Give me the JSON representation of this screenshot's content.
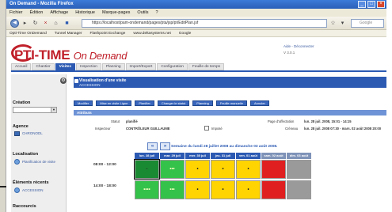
{
  "window": {
    "title": "On Demand - Mozilla Firefox",
    "buttons": [
      "_",
      "□",
      "×"
    ]
  },
  "menu": [
    "Fichier",
    "Édition",
    "Affichage",
    "Historique",
    "Marque-pages",
    "Outils",
    "?"
  ],
  "nav": {
    "url": "https://localhost/pam-ondemand/pages/pta/jsp/pt/EditPlan.jsf",
    "search_placeholder": "Google"
  },
  "bookmarks": [
    "Opti-Time OnDemand",
    "Tunnel Manager",
    "Flashpoint Exchange",
    "www.deltasystems.net",
    "Google"
  ],
  "brand": {
    "logo_main": "PTI-TIME",
    "logo_sub": "On Demand",
    "header_links": "Aide - Déconnecter",
    "version": "V 3.0.1"
  },
  "tabs": [
    "Accueil",
    "Chantier",
    "Visites",
    "Inspection",
    "Planning",
    "Import/Export",
    "Configuration",
    "Feuille de temps"
  ],
  "active_tab": "Visites",
  "sidebar": {
    "creation_label": "Création",
    "agence_label": "Agence",
    "agence_link": "CHRONODL",
    "localisation_label": "Localisation",
    "localisation_link": "Planification de visite",
    "recents_label": "Éléments récents",
    "recents_link": "ACCESSION",
    "raccourcis_label": "Raccourcis"
  },
  "main": {
    "header_title": "Visualisation d'une visite",
    "header_sub": "ACCESSION",
    "buttons": [
      "Modifier",
      "Mise en visite Ligne",
      "Planifier",
      "Changer le statut",
      "Planning",
      "Feuille manuelle",
      "Annuler"
    ],
    "info_title": "Attributs",
    "statut_label": "Statut",
    "statut_value": "planifié",
    "inspecteur_label": "Inspecteur",
    "inspecteur_value": "CONTRÔLEUR GUILLAUME",
    "impose_label": "Imposé",
    "page_date_label": "Page d'affectation",
    "page_date_value": "lun. 28 juil. 2008, 15:01 - 14:15",
    "creneau_label": "Créneau",
    "creneau_value": "lun. 28 juil. 2008 07:30 - mars. 02 août 2008 20:00"
  },
  "week": {
    "prev": "«",
    "next": "»",
    "title": "Semaine du lundi 28 juillet 2008 au dimanche 03 août 2008.",
    "days": [
      "lun. 28 juil",
      "mar. 29 juil",
      "mer. 30 juil",
      "jeu. 31 juil",
      "ven. 01 août",
      "sam. 02 août",
      "dim. 03 août"
    ],
    "slots": [
      {
        "label": "08:00 - 12:00",
        "cells": [
          {
            "status": "green-dark",
            "text": "-"
          },
          {
            "status": "green",
            "text": "•••"
          },
          {
            "status": "yellow",
            "text": "•"
          },
          {
            "status": "yellow",
            "text": "•"
          },
          {
            "status": "yellow",
            "text": "•"
          },
          {
            "status": "red",
            "text": ""
          },
          {
            "status": "grey",
            "text": ""
          }
        ]
      },
      {
        "label": "14:00 - 18:00",
        "cells": [
          {
            "status": "green",
            "text": "••••"
          },
          {
            "status": "green",
            "text": "•••"
          },
          {
            "status": "yellow",
            "text": "•"
          },
          {
            "status": "yellow",
            "text": "•"
          },
          {
            "status": "yellow",
            "text": "•"
          },
          {
            "status": "red",
            "text": ""
          },
          {
            "status": "grey",
            "text": ""
          }
        ]
      }
    ]
  },
  "colors": {
    "brand_red": "#c0202a",
    "primary_blue": "#2c5ab3",
    "slot_green_dark": "#1a8a32",
    "slot_green": "#35c24a",
    "slot_yellow": "#ffd400",
    "slot_red": "#e02020",
    "slot_grey": "#9a9a9a"
  }
}
